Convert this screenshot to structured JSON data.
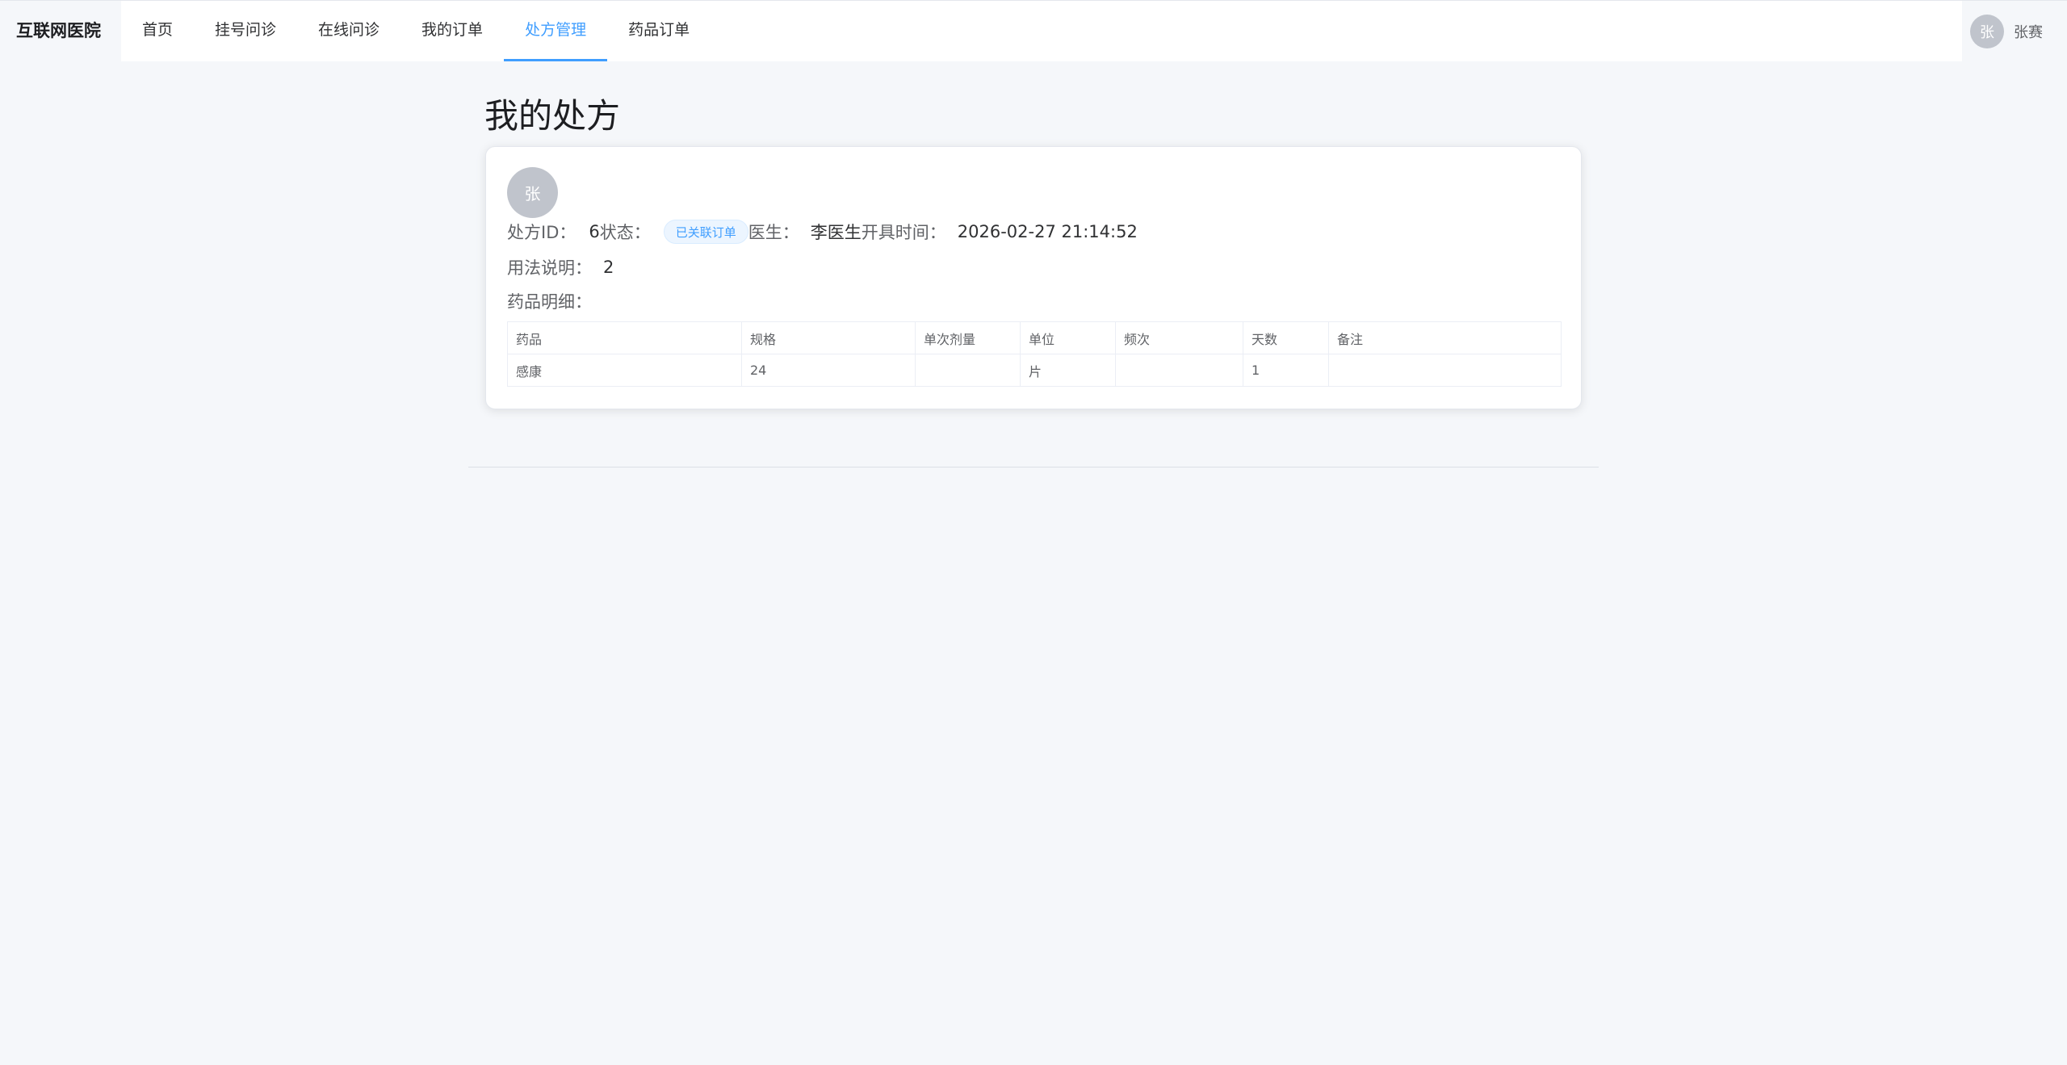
{
  "app": {
    "brand": "互联网医院"
  },
  "nav": {
    "items": [
      {
        "label": "首页"
      },
      {
        "label": "挂号问诊"
      },
      {
        "label": "在线问诊"
      },
      {
        "label": "我的订单"
      },
      {
        "label": "处方管理"
      },
      {
        "label": "药品订单"
      }
    ],
    "active_index": 4
  },
  "user": {
    "avatar_text": "张",
    "name": "张赛"
  },
  "page": {
    "title": "我的处方"
  },
  "prescription": {
    "doctor_avatar_text": "张",
    "id_label": "处方ID：",
    "id_value": "6",
    "status_label": "状态：",
    "status_tag": "已关联订单",
    "doctor_label": "医生：",
    "doctor_value": "李医生",
    "time_label": "开具时间：",
    "time_value": "2026-02-27 21:14:52",
    "usage_label": "用法说明：",
    "usage_value": "2",
    "detail_label": "药品明细：",
    "table": {
      "headers": [
        "药品",
        "规格",
        "单次剂量",
        "单位",
        "频次",
        "天数",
        "备注"
      ],
      "rows": [
        [
          "感康",
          "24",
          "",
          "片",
          "",
          "1",
          ""
        ]
      ]
    }
  },
  "colors": {
    "accent": "#409eff",
    "background": "#f5f7fa",
    "card": "#ffffff",
    "avatar": "#c0c4cc"
  },
  "icons": {
    "user_avatar": "avatar-icon",
    "doctor_avatar": "avatar-icon"
  }
}
